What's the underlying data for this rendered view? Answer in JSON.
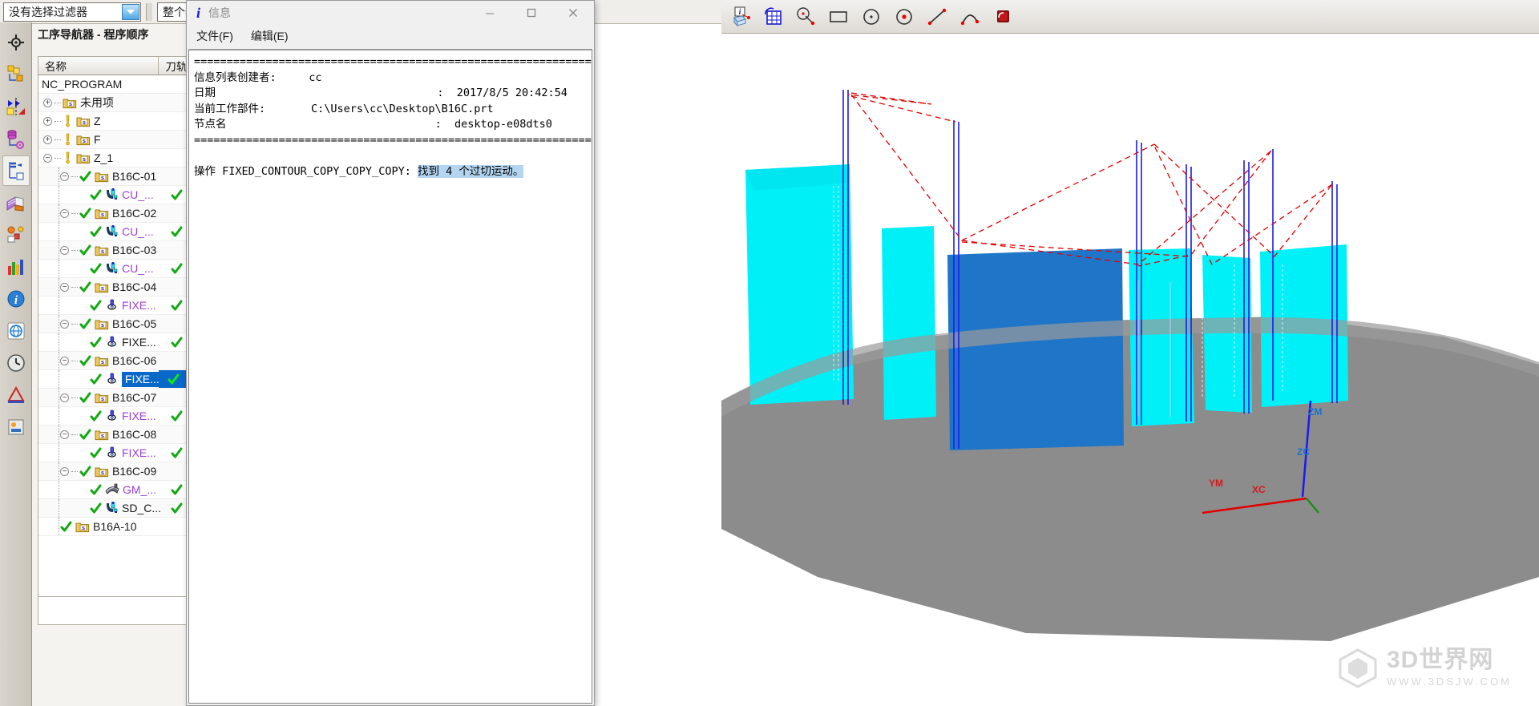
{
  "filter_bar": {
    "filter_select": {
      "value": "没有选择过滤器",
      "icon": "chevron-down-icon"
    },
    "scope_select": {
      "value": "整个装配"
    }
  },
  "resource_bar": {
    "items": [
      {
        "name": "home-icon",
        "label": ""
      },
      {
        "name": "assembly-navigator-icon",
        "label": ""
      },
      {
        "name": "constraint-navigator-icon",
        "label": ""
      },
      {
        "name": "part-navigator-icon",
        "label": ""
      },
      {
        "name": "operation-navigator-icon",
        "label": ""
      },
      {
        "name": "reuse-library-icon",
        "label": ""
      },
      {
        "name": "hd3d-tools-icon",
        "label": ""
      },
      {
        "name": "web-browser-icon",
        "label": ""
      },
      {
        "name": "history-icon",
        "label": ""
      },
      {
        "name": "process-studio-icon",
        "label": ""
      },
      {
        "name": "roles-icon",
        "label": ""
      },
      {
        "name": "system-scenes-icon",
        "label": ""
      }
    ]
  },
  "navigator": {
    "title": "工序导航器 - 程序顺序",
    "columns": [
      "名称",
      "刀轨"
    ],
    "rows": [
      {
        "level": 0,
        "expander": "",
        "status": "",
        "icon": "",
        "label": "NC_PROGRAM",
        "label_color": "black",
        "path_check": false,
        "selected": false
      },
      {
        "level": 1,
        "expander": "+",
        "status": "",
        "icon": "program-folder",
        "label": "未用项",
        "label_color": "black",
        "path_check": false,
        "selected": false
      },
      {
        "level": 1,
        "expander": "+",
        "status": "warning",
        "icon": "program-folder",
        "label": "Z",
        "label_color": "black",
        "path_check": false,
        "selected": false
      },
      {
        "level": 1,
        "expander": "+",
        "status": "warning",
        "icon": "program-folder",
        "label": "F",
        "label_color": "black",
        "path_check": false,
        "selected": false
      },
      {
        "level": 1,
        "expander": "-",
        "status": "warning",
        "icon": "program-folder",
        "label": "Z_1",
        "label_color": "black",
        "path_check": false,
        "selected": false
      },
      {
        "level": 2,
        "expander": "-",
        "status": "check",
        "icon": "program-folder",
        "label": "B16C-01",
        "label_color": "black",
        "path_check": false,
        "selected": false
      },
      {
        "level": 3,
        "expander": "",
        "status": "check",
        "icon": "contour-tool",
        "label": "CU_...",
        "label_color": "purple",
        "path_check": true,
        "selected": false
      },
      {
        "level": 2,
        "expander": "-",
        "status": "check",
        "icon": "program-folder",
        "label": "B16C-02",
        "label_color": "black",
        "path_check": false,
        "selected": false
      },
      {
        "level": 3,
        "expander": "",
        "status": "check",
        "icon": "contour-tool",
        "label": "CU_...",
        "label_color": "purple",
        "path_check": true,
        "selected": false
      },
      {
        "level": 2,
        "expander": "-",
        "status": "check",
        "icon": "program-folder",
        "label": "B16C-03",
        "label_color": "black",
        "path_check": false,
        "selected": false
      },
      {
        "level": 3,
        "expander": "",
        "status": "check",
        "icon": "contour-tool",
        "label": "CU_...",
        "label_color": "purple",
        "path_check": true,
        "selected": false
      },
      {
        "level": 2,
        "expander": "-",
        "status": "check",
        "icon": "program-folder",
        "label": "B16C-04",
        "label_color": "black",
        "path_check": false,
        "selected": false
      },
      {
        "level": 3,
        "expander": "",
        "status": "check",
        "icon": "fixed-contour",
        "label": "FIXE...",
        "label_color": "purple",
        "path_check": true,
        "selected": false
      },
      {
        "level": 2,
        "expander": "-",
        "status": "check",
        "icon": "program-folder",
        "label": "B16C-05",
        "label_color": "black",
        "path_check": false,
        "selected": false
      },
      {
        "level": 3,
        "expander": "",
        "status": "check",
        "icon": "fixed-contour",
        "label": "FIXE...",
        "label_color": "black",
        "path_check": true,
        "selected": false
      },
      {
        "level": 2,
        "expander": "-",
        "status": "check",
        "icon": "program-folder",
        "label": "B16C-06",
        "label_color": "black",
        "path_check": false,
        "selected": false
      },
      {
        "level": 3,
        "expander": "",
        "status": "check",
        "icon": "fixed-contour",
        "label": "FIXE...",
        "label_color": "white",
        "path_check": true,
        "selected": true
      },
      {
        "level": 2,
        "expander": "-",
        "status": "check",
        "icon": "program-folder",
        "label": "B16C-07",
        "label_color": "black",
        "path_check": false,
        "selected": false
      },
      {
        "level": 3,
        "expander": "",
        "status": "check",
        "icon": "fixed-contour",
        "label": "FIXE...",
        "label_color": "purple",
        "path_check": true,
        "selected": false
      },
      {
        "level": 2,
        "expander": "-",
        "status": "check",
        "icon": "program-folder",
        "label": "B16C-08",
        "label_color": "black",
        "path_check": false,
        "selected": false
      },
      {
        "level": 3,
        "expander": "",
        "status": "check",
        "icon": "fixed-contour",
        "label": "FIXE...",
        "label_color": "purple",
        "path_check": true,
        "selected": false
      },
      {
        "level": 2,
        "expander": "-",
        "status": "check",
        "icon": "program-folder",
        "label": "B16C-09",
        "label_color": "black",
        "path_check": false,
        "selected": false
      },
      {
        "level": 3,
        "expander": "",
        "status": "check",
        "icon": "surface-mill",
        "label": "GM_...",
        "label_color": "purple",
        "path_check": true,
        "selected": false
      },
      {
        "level": 3,
        "expander": "",
        "status": "check",
        "icon": "contour-tool",
        "label": "SD_C...",
        "label_color": "black",
        "path_check": true,
        "selected": false
      },
      {
        "level": 2,
        "expander": "",
        "status": "check",
        "icon": "program-folder",
        "label": "B16A-10",
        "label_color": "black",
        "path_check": false,
        "selected": false
      }
    ]
  },
  "info_dialog": {
    "title": "信息",
    "title_icon": "info-italic-icon",
    "menus": [
      {
        "label": "文件(F)",
        "name": "menu-file"
      },
      {
        "label": "编辑(E)",
        "name": "menu-edit"
      }
    ],
    "window_controls": [
      {
        "name": "minimize-button",
        "glyph": "—"
      },
      {
        "name": "maximize-button",
        "glyph": "□"
      },
      {
        "name": "close-button",
        "glyph": "✕"
      }
    ],
    "separator": "=============================================================================",
    "lines": [
      {
        "label": "信息列表创建者:",
        "value": "cc"
      },
      {
        "label": "日期",
        "value": "2017/8/5 20:42:54"
      },
      {
        "label": "当前工作部件:",
        "value": "C:\\Users\\cc\\Desktop\\B16C.prt"
      },
      {
        "label": "节点名",
        "value": "desktop-e08dts0"
      }
    ],
    "body_text_plain": "操作 FIXED_CONTOUR_COPY_COPY_COPY: ",
    "body_text_highlight": "找到 4 个过切运动。"
  },
  "nx_toolbar": {
    "buttons": [
      {
        "name": "information-object-icon"
      },
      {
        "name": "grid-workplane-icon"
      },
      {
        "name": "arc-center-point-icon"
      },
      {
        "name": "rectangle-icon"
      },
      {
        "name": "circle-icon"
      },
      {
        "name": "circle-center-icon"
      },
      {
        "name": "line-icon"
      },
      {
        "name": "arc-icon"
      },
      {
        "name": "fillet-box-icon"
      }
    ]
  },
  "viewport": {
    "axis_labels": [
      {
        "text": "ZM",
        "color": "#1a6fd4"
      },
      {
        "text": "ZC",
        "color": "#1a6fd4"
      },
      {
        "text": "YM",
        "color": "#d41a1a"
      },
      {
        "text": "XC",
        "color": "#d41a1a"
      }
    ],
    "watermark": {
      "title": "3D世界网",
      "subtitle": "WWW.3DSJW.COM",
      "logo": "cube-logo-icon"
    },
    "colors": {
      "part_cyan": "#00f0f8",
      "part_blue": "#1f76c8",
      "stock_gray": "#8c8c8c",
      "toolpath_red": "#e00000",
      "toolpath_blue": "#1a1aee"
    }
  }
}
